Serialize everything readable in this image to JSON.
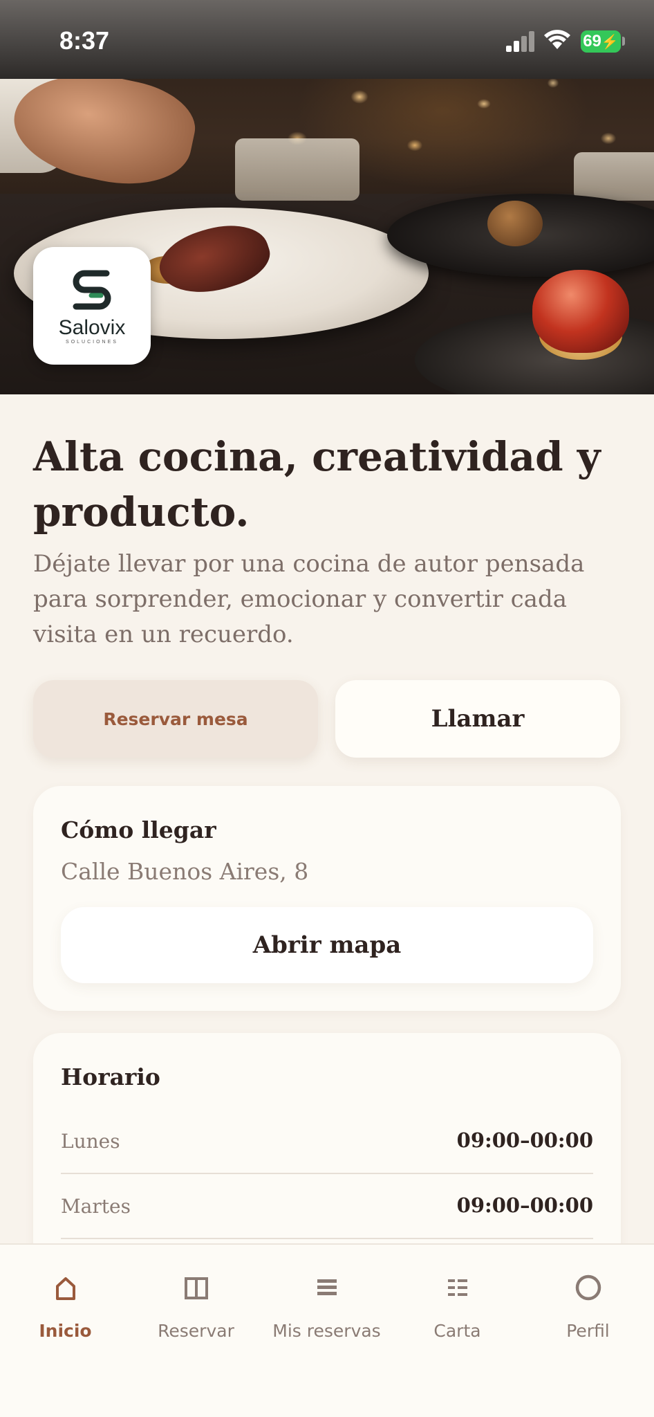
{
  "status_bar": {
    "time": "8:37",
    "battery": "69"
  },
  "hero": {
    "logo_name": "Salovix",
    "logo_tagline": "SOLUCIONES"
  },
  "intro": {
    "headline": "Alta cocina, creatividad y producto.",
    "subtitle": "Déjate llevar por una cocina de autor pensada para sorprender, emocionar y convertir cada visita en un recuerdo."
  },
  "actions": {
    "reserve_label": "Reservar mesa",
    "call_label": "Llamar"
  },
  "directions": {
    "title": "Cómo llegar",
    "address": "Calle Buenos Aires, 8",
    "map_button": "Abrir mapa"
  },
  "hours": {
    "title": "Horario",
    "rows": [
      {
        "day": "Lunes",
        "range": "09:00–00:00"
      },
      {
        "day": "Martes",
        "range": "09:00–00:00"
      }
    ]
  },
  "nav": {
    "items": [
      {
        "label": "Inicio",
        "icon": "home-icon",
        "active": true
      },
      {
        "label": "Reservar",
        "icon": "book-icon",
        "active": false
      },
      {
        "label": "Mis reservas",
        "icon": "list-icon",
        "active": false
      },
      {
        "label": "Carta",
        "icon": "menu-grid-icon",
        "active": false
      },
      {
        "label": "Perfil",
        "icon": "profile-icon",
        "active": false
      }
    ]
  },
  "colors": {
    "accent": "#9a5a3c",
    "background": "#f8f3ec",
    "card": "#fdfbf6",
    "text": "#2f2320",
    "muted": "#8a7b74"
  }
}
